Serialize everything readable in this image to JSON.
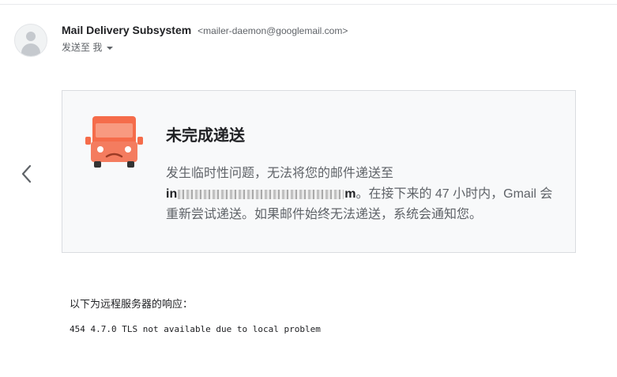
{
  "sender": {
    "name": "Mail Delivery Subsystem",
    "email": "<mailer-daemon@googlemail.com>"
  },
  "recipient_line": "发送至 我",
  "icons": {
    "avatar": "person-avatar-icon",
    "caret": "chevron-down-icon",
    "prev": "chevron-left-icon",
    "truck": "delivery-truck-icon"
  },
  "colors": {
    "truck_orange": "#f56c4a",
    "card_background": "#f8f9fa",
    "muted_text": "#5f6368"
  },
  "card": {
    "title": "未完成递送",
    "message_line1": "发生临时性问题，无法将您的邮件递送至",
    "address_start": "in",
    "address_end": "m",
    "message_after_address": "。在接下来的 47 小时内，Gmail 会",
    "message_line3": "重新尝试递送。如果邮件始终无法递送，系统会通知您。"
  },
  "response": {
    "label": "以下为远程服务器的响应：",
    "code": "454 4.7.0 TLS not available due to local problem"
  }
}
